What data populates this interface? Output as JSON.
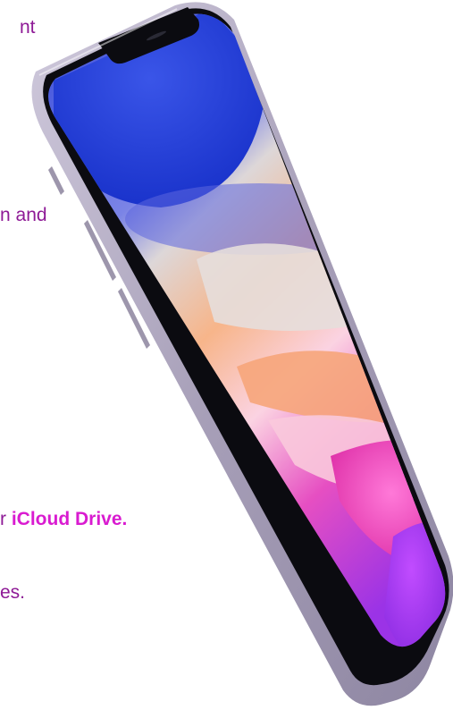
{
  "text": {
    "line1": "nt",
    "line2": "n and",
    "line3_plain": "r ",
    "line3_bold": "iCloud Drive.",
    "line4": "es."
  },
  "colors": {
    "text": "#8e1a96",
    "highlight": "#d91bd0",
    "phone_frame": "#b9b2c8",
    "bezel": "#0b0b10"
  }
}
